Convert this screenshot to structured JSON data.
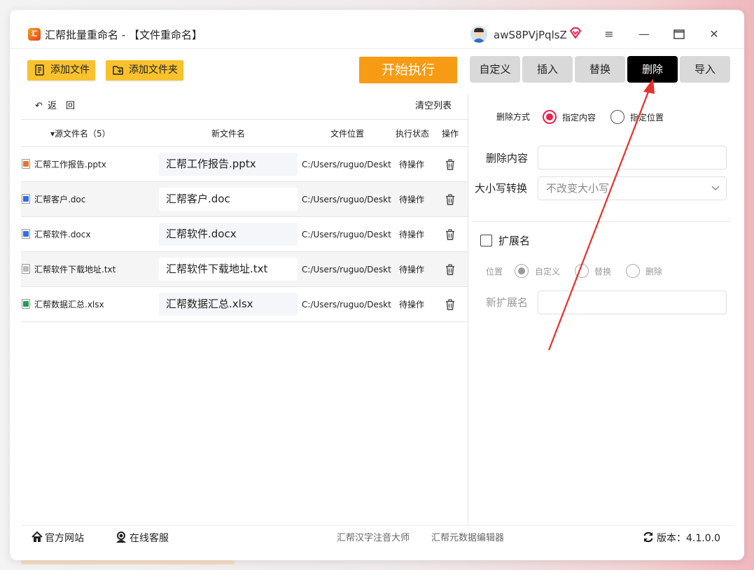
{
  "window": {
    "title": "汇帮批量重命名 - 【文件重命名】",
    "logo_text": "汇",
    "username": "awS8PVjPqlsZ",
    "controls": [
      "menu-icon",
      "minimize-icon",
      "maximize-icon",
      "close-icon"
    ]
  },
  "toolbar": {
    "add_file": "添加文件",
    "add_folder": "添加文件夹",
    "start": "开始执行",
    "tabs": [
      {
        "label": "自定义",
        "active": false
      },
      {
        "label": "插入",
        "active": false
      },
      {
        "label": "替换",
        "active": false
      },
      {
        "label": "删除",
        "active": true
      },
      {
        "label": "导入",
        "active": false
      }
    ]
  },
  "list": {
    "back_label": "返　回",
    "clear_label": "清空列表",
    "columns": {
      "source": "源文件名（5）",
      "new": "新文件名",
      "location": "文件位置",
      "status": "执行状态",
      "action": "操作"
    },
    "rows": [
      {
        "src": "汇帮工作报告.pptx",
        "new": "汇帮工作报告.pptx",
        "loc": "C:/Users/ruguo/Desktop",
        "status": "待操作",
        "icon": "pptx-file-icon",
        "color": "#e8742b"
      },
      {
        "src": "汇帮客户.doc",
        "new": "汇帮客户.doc",
        "loc": "C:/Users/ruguo/Desktop",
        "status": "待操作",
        "icon": "doc-file-icon",
        "color": "#2b6fe8"
      },
      {
        "src": "汇帮软件.docx",
        "new": "汇帮软件.docx",
        "loc": "C:/Users/ruguo/Desktop",
        "status": "待操作",
        "icon": "docx-file-icon",
        "color": "#2b6fe8"
      },
      {
        "src": "汇帮软件下载地址.txt",
        "new": "汇帮软件下载地址.txt",
        "loc": "C:/Users/ruguo/Desktop",
        "status": "待操作",
        "icon": "txt-file-icon",
        "color": "#bbbbbb"
      },
      {
        "src": "汇帮数据汇总.xlsx",
        "new": "汇帮数据汇总.xlsx",
        "loc": "C:/Users/ruguo/Desktop",
        "status": "待操作",
        "icon": "xlsx-file-icon",
        "color": "#1f9d55"
      }
    ]
  },
  "delete_panel": {
    "method_label": "删除方式",
    "method_options": [
      {
        "label": "指定内容",
        "selected": true
      },
      {
        "label": "指定位置",
        "selected": false
      }
    ],
    "content_label": "删除内容",
    "content_value": "",
    "case_label": "大小写转换",
    "case_value": "不改变大小写",
    "ext_label": "扩展名",
    "ext_checked": false,
    "position_label": "位置",
    "position_options": [
      {
        "label": "自定义",
        "selected": true
      },
      {
        "label": "替换",
        "selected": false
      },
      {
        "label": "删除",
        "selected": false
      }
    ],
    "new_ext_label": "新扩展名",
    "new_ext_value": ""
  },
  "footer": {
    "website": "官方网站",
    "support": "在线客服",
    "link1": "汇帮汉字注音大师",
    "link2": "汇帮元数据编辑器",
    "version_label": "版本：",
    "version": "4.1.0.0"
  },
  "colors": {
    "accent_yellow": "#f8c22e",
    "start_orange": "#f69b13",
    "active_tab": "#000000",
    "radio_red": "#e8234d",
    "arrow_red": "#e8302a"
  }
}
